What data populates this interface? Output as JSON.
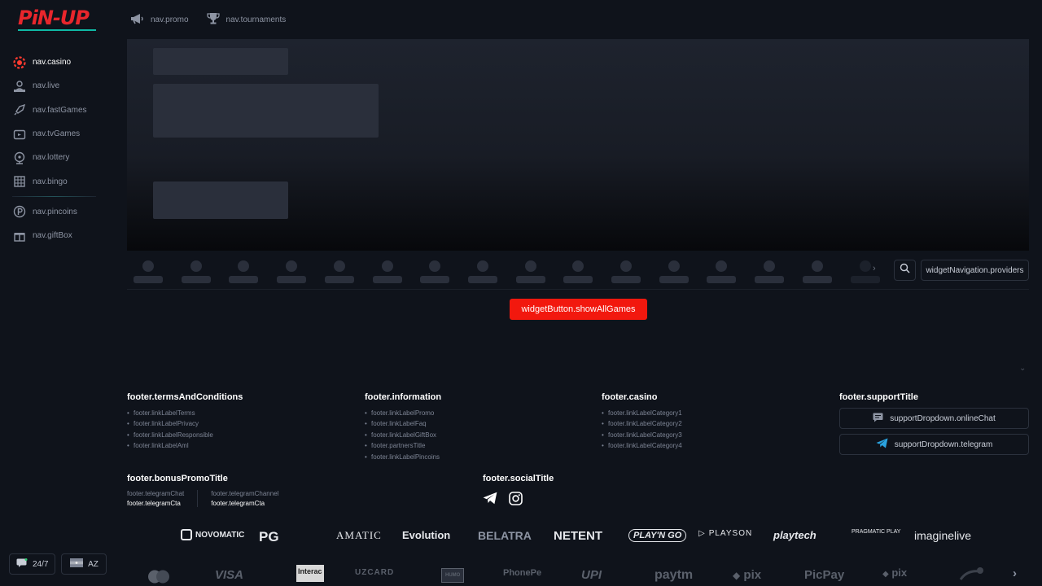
{
  "logo": {
    "text": "PiN-UP"
  },
  "sidebar": {
    "items": [
      {
        "label": "nav.casino",
        "icon": "casino-chip-icon",
        "active": true
      },
      {
        "label": "nav.live",
        "icon": "live-dealer-icon"
      },
      {
        "label": "nav.fastGames",
        "icon": "rocket-icon"
      },
      {
        "label": "nav.tvGames",
        "icon": "tv-icon"
      },
      {
        "label": "nav.lottery",
        "icon": "lottery-icon"
      },
      {
        "label": "nav.bingo",
        "icon": "bingo-icon"
      }
    ],
    "extra_items": [
      {
        "label": "nav.pincoins",
        "icon": "pincoin-icon"
      },
      {
        "label": "nav.giftBox",
        "icon": "gift-icon"
      }
    ],
    "support_label": "24/7",
    "language_label": "AZ"
  },
  "topnav": {
    "promo": "nav.promo",
    "tournaments": "nav.tournaments"
  },
  "widget": {
    "providers_label": "widgetNavigation.providers",
    "show_all_label": "widgetButton.showAllGames"
  },
  "footer": {
    "terms": {
      "title": "footer.termsAndConditions",
      "links": [
        "footer.linkLabelTerms",
        "footer.linkLabelPrivacy",
        "footer.linkLabelResponsible",
        "footer.linkLabelAml"
      ]
    },
    "information": {
      "title": "footer.information",
      "links": [
        "footer.linkLabelPromo",
        "footer.linkLabelFaq",
        "footer.linkLabelGiftBox",
        "footer.partnersTitle",
        "footer.linkLabelPincoins"
      ]
    },
    "casino": {
      "title": "footer.casino",
      "links": [
        "footer.linkLabelCategory1",
        "footer.linkLabelCategory2",
        "footer.linkLabelCategory3",
        "footer.linkLabelCategory4"
      ]
    },
    "support": {
      "title": "footer.supportTitle",
      "online_chat": "supportDropdown.onlineChat",
      "telegram": "supportDropdown.telegram"
    },
    "bonus": {
      "title": "footer.bonusPromoTitle",
      "chat_label": "footer.telegramChat",
      "chat_cta": "footer.telegramCta",
      "channel_label": "footer.telegramChannel",
      "channel_cta": "footer.telegramCta"
    },
    "social": {
      "title": "footer.socialTitle"
    },
    "providers": [
      "NOVOMATIC",
      "PG",
      "AMATIC",
      "Evolution",
      "BELATRA",
      "NETENT",
      "PLAY'N GO",
      "PLAYSON",
      "playtech",
      "PRAGMATIC PLAY",
      "imaginelive"
    ],
    "payments": [
      "VISA",
      "Interac",
      "UZCARD",
      "HUMO",
      "PhonePe",
      "UPI",
      "paytm",
      "pix",
      "PicPay",
      "pix"
    ]
  }
}
